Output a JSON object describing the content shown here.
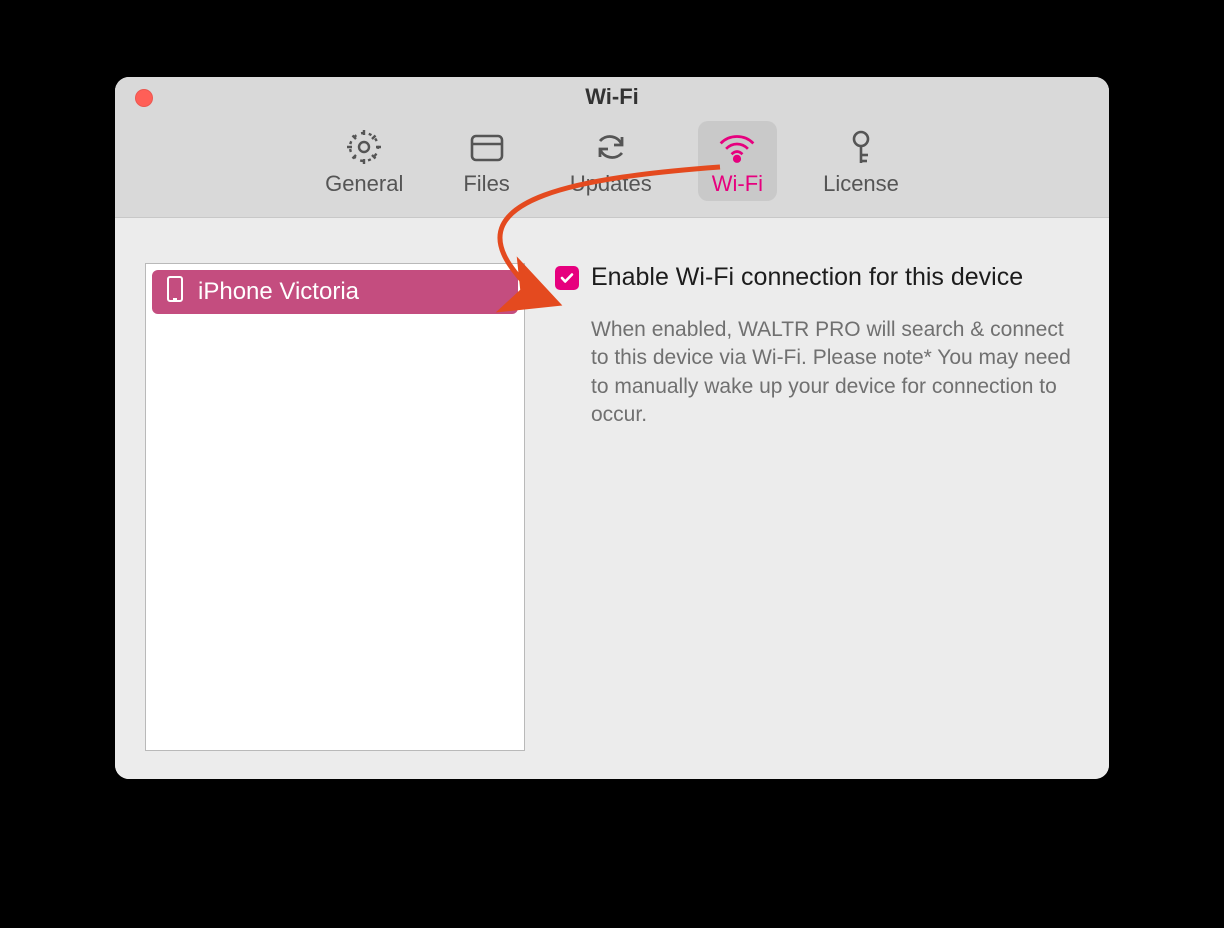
{
  "window": {
    "title": "Wi-Fi"
  },
  "toolbar": {
    "tabs": [
      {
        "id": "general",
        "label": "General",
        "icon": "gear-icon",
        "active": false
      },
      {
        "id": "files",
        "label": "Files",
        "icon": "folder-icon",
        "active": false
      },
      {
        "id": "updates",
        "label": "Updates",
        "icon": "refresh-icon",
        "active": false
      },
      {
        "id": "wifi",
        "label": "Wi-Fi",
        "icon": "wifi-icon",
        "active": true
      },
      {
        "id": "license",
        "label": "License",
        "icon": "key-icon",
        "active": false
      }
    ]
  },
  "devices": [
    {
      "name": "iPhone Victoria",
      "selected": true
    }
  ],
  "wifi": {
    "enable_label": "Enable Wi-Fi connection for this device",
    "enable_checked": true,
    "description": "When enabled, WALTR PRO will search & connect to this device via Wi-Fi. Please note* You may need to manually wake up your device for connection to occur."
  },
  "colors": {
    "accent": "#e6007e"
  }
}
